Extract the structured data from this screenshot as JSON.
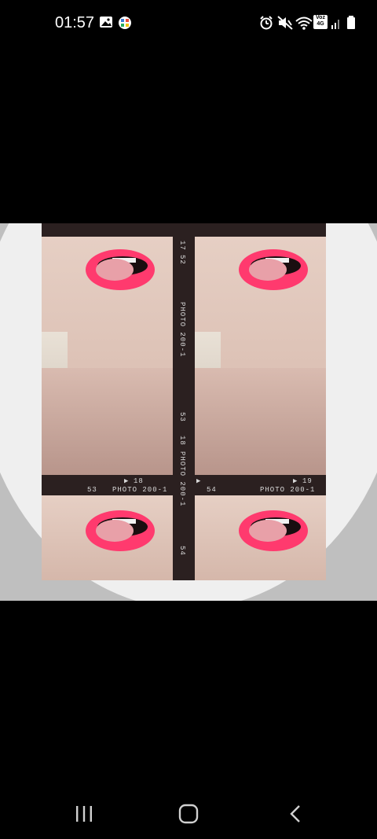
{
  "status_bar": {
    "time": "01:57",
    "icons": [
      "gallery-icon",
      "app-icon",
      "alarm-icon",
      "mute-icon",
      "wifi-icon",
      "volte-icon",
      "signal-icon",
      "battery-icon"
    ],
    "volte_label_top": "Voz",
    "volte_label_bottom": "4G"
  },
  "image": {
    "film_labels": {
      "top_mid_a": "17",
      "top_mid_b": "52",
      "left_bottom_num": "18",
      "left_bottom_code": "53",
      "left_bottom_text": "PHOTO 200-1",
      "right_bottom_num": "19",
      "right_bottom_code": "54",
      "right_bottom_text": "PHOTO 200-1",
      "vert_upper": "PHOTO 200-1",
      "vert_mid_code": "53",
      "vert_mid_num": "18",
      "vert_mid_text": "PHOTO 200-1",
      "vert_bottom_code": "54"
    },
    "colors": {
      "lip": "#ff3a6e",
      "frame": "#2b2020",
      "circle": "#efefef",
      "side": "#bfbfbf"
    }
  },
  "nav": {
    "recent": "recent-apps-icon",
    "home": "home-icon",
    "back": "back-icon"
  }
}
